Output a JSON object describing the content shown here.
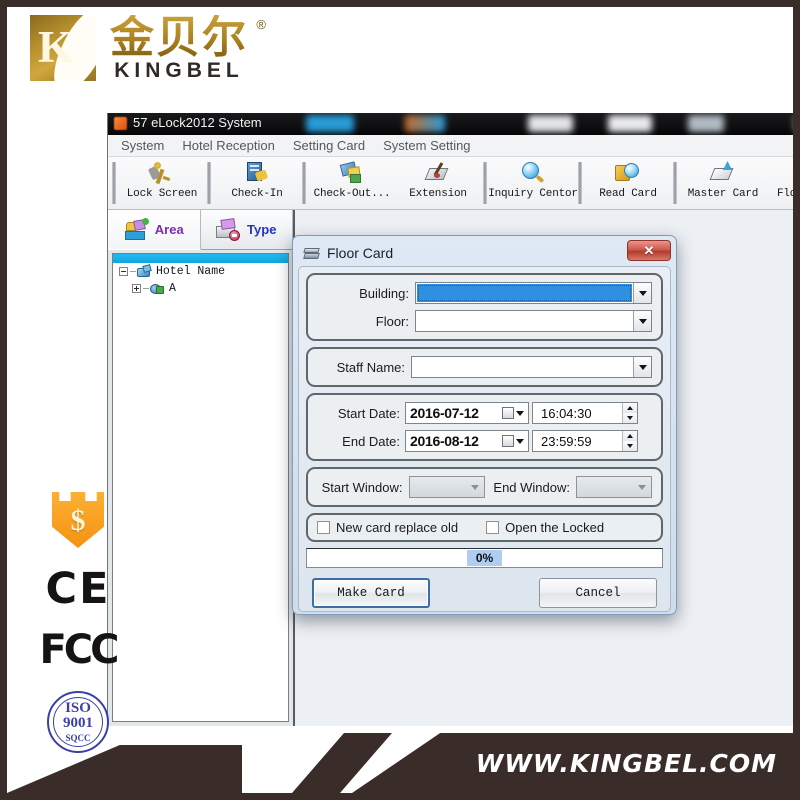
{
  "brand": {
    "logo_letter": "K",
    "chinese_name": "金贝尔",
    "registered_mark": "®",
    "english_name": "KINGBEL"
  },
  "app_window": {
    "titlebar": {
      "title": "57 eLock2012 System",
      "icon": "app-icon"
    },
    "menubar": [
      {
        "label": "System"
      },
      {
        "label": "Hotel Reception"
      },
      {
        "label": "Setting Card"
      },
      {
        "label": "System Setting"
      }
    ],
    "toolbar": [
      {
        "label": "Lock Screen",
        "icon": "key-icon"
      },
      {
        "label": "Check-In",
        "icon": "book-icon"
      },
      {
        "label": "Check-Out...",
        "icon": "card-icon"
      },
      {
        "label": "Extension",
        "icon": "pen-icon"
      },
      {
        "label": "Inquiry Centor",
        "icon": "magnifier-icon"
      },
      {
        "label": "Read Card",
        "icon": "read-card-icon"
      },
      {
        "label": "Master Card",
        "icon": "master-card-icon"
      },
      {
        "label": "Floor Card",
        "icon": "floor-card-icon"
      }
    ],
    "sidebar": {
      "tabs": [
        {
          "label": "Area",
          "icon": "area-icon",
          "active": true
        },
        {
          "label": "Type",
          "icon": "type-icon",
          "active": false
        }
      ],
      "tree": [
        {
          "label": "Hotel Name",
          "icon": "hotel-icon",
          "expanded": true
        },
        {
          "label": "A",
          "icon": "building-icon",
          "expanded": false
        }
      ]
    }
  },
  "dialog": {
    "title": "Floor Card",
    "icon": "floor-card-icon",
    "close_label": "✕",
    "fields": {
      "building_label": "Building:",
      "building_value": "",
      "floor_label": "Floor:",
      "floor_value": "",
      "staff_name_label": "Staff Name:",
      "staff_name_value": "",
      "start_date_label": "Start Date:",
      "start_date_value": "2016-07-12",
      "start_time_value": "16:04:30",
      "end_date_label": "End Date:",
      "end_date_value": "2016-08-12",
      "end_time_value": "23:59:59",
      "start_window_label": "Start Window:",
      "start_window_value": "",
      "end_window_label": "End Window:",
      "end_window_value": ""
    },
    "checkboxes": [
      {
        "label": "New card replace old",
        "checked": false
      },
      {
        "label": "Open the Locked",
        "checked": false
      }
    ],
    "progress": {
      "value": "0%"
    },
    "buttons": [
      {
        "label": "Make Card",
        "focused": true
      },
      {
        "label": "Cancel",
        "focused": false
      }
    ]
  },
  "badges": [
    {
      "name": "money-back-shield",
      "text": "$"
    },
    {
      "name": "ce-mark",
      "text": "CE"
    },
    {
      "name": "fcc-mark",
      "text": "FCC"
    },
    {
      "name": "iso-mark",
      "line1": "ISO",
      "line2": "9001",
      "line3": "SQCC"
    }
  ],
  "footer": {
    "url": "WWW.KINGBEL.COM"
  },
  "colors": {
    "brand_gold": "#a8801f",
    "footer_brown": "#3a2c29",
    "selection_blue": "#2f8fe0",
    "close_red": "#cf5a4d"
  }
}
